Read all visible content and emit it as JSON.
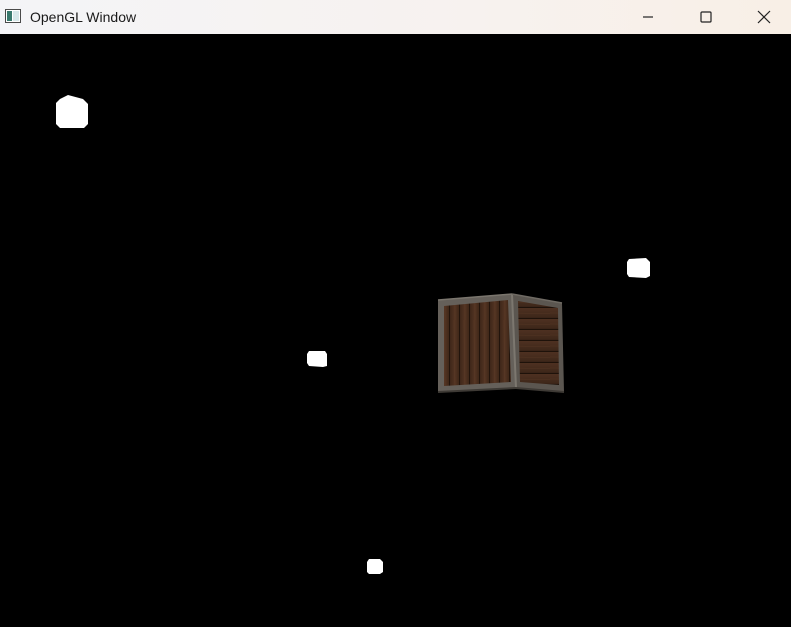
{
  "window": {
    "title": "OpenGL Window"
  },
  "icons": {
    "app": "opengl-app-icon",
    "minimize": "minimize-icon",
    "maximize": "maximize-icon",
    "close": "close-icon"
  },
  "colors": {
    "background": "#000000",
    "light_cube": "#ffffff",
    "crate_wood": "#4a2f1f",
    "crate_frame": "#6b665e"
  }
}
